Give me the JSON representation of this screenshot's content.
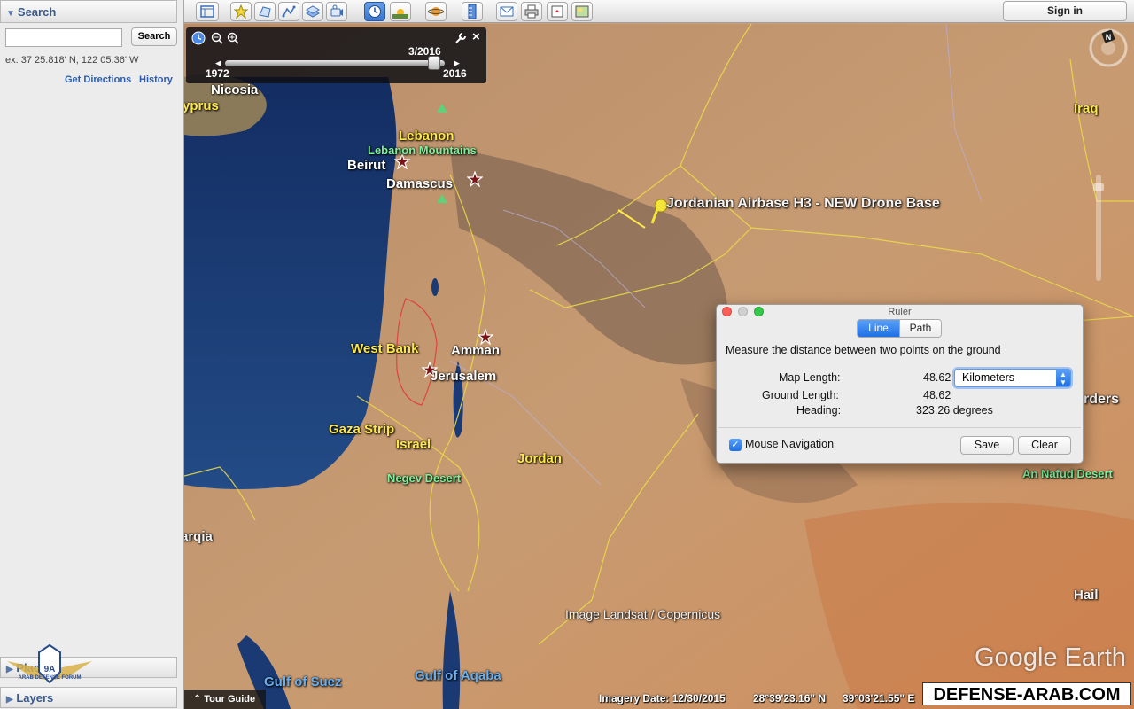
{
  "sidebar": {
    "search_header": "Search",
    "search_button": "Search",
    "search_input_value": "",
    "example_text": "ex: 37 25.818' N, 122 05.36' W",
    "get_directions": "Get Directions",
    "history": "History",
    "places_label": "Plac",
    "layers_label": "Layers",
    "logo_text": "ARAB DEFENSE FORUM"
  },
  "toolbar": {
    "sign_in": "Sign in",
    "icons": [
      "sidebar-toggle-icon",
      "placemark-icon",
      "polygon-icon",
      "path-icon",
      "image-overlay-icon",
      "record-tour-icon",
      "historical-imagery-icon",
      "sunlight-icon",
      "planets-icon",
      "ruler-icon",
      "email-icon",
      "print-icon",
      "save-image-icon",
      "view-in-maps-icon"
    ]
  },
  "time_slider": {
    "current_date": "3/2016",
    "start_year": "1972",
    "end_year": "2016",
    "position_fraction": 0.95
  },
  "map": {
    "labels": {
      "nicosia": "Nicosia",
      "cyprus": "yprus",
      "lebanon": "Lebanon",
      "lebanon_mountains": "Lebanon Mountains",
      "beirut": "Beirut",
      "damascus": "Damascus",
      "airbase": "Jordanian Airbase H3 - NEW Drone Base",
      "west_bank": "West Bank",
      "amman": "Amman",
      "jerusalem": "Jerusalem",
      "gaza_strip": "Gaza Strip",
      "israel": "Israel",
      "jordan": "Jordan",
      "negev_desert": "Negev Desert",
      "iraq": "Iraq",
      "borders": "rders",
      "an_nafud": "An Nafud Desert",
      "hail": "Hail",
      "arqia": "arqia",
      "gulf_of_suez": "Gulf of Suez",
      "gulf_of_aqaba": "Gulf of Aqaba",
      "imagery_credit": "Image Landsat / Copernicus"
    },
    "google_earth_logo": "Google Earth",
    "compass_letter": "N"
  },
  "ruler": {
    "title": "Ruler",
    "tab_line": "Line",
    "tab_path": "Path",
    "description": "Measure the distance between two points on the ground",
    "map_length_label": "Map Length:",
    "map_length_value": "48.62",
    "unit": "Kilometers",
    "ground_length_label": "Ground Length:",
    "ground_length_value": "48.62",
    "heading_label": "Heading:",
    "heading_value": "323.26 degrees",
    "mouse_navigation_label": "Mouse Navigation",
    "mouse_navigation_checked": true,
    "save": "Save",
    "clear": "Clear"
  },
  "status_bar": {
    "tour_guide": "Tour Guide",
    "imagery_date": "Imagery Date: 12/30/2015",
    "latitude": "28°39'23.16\" N",
    "longitude": "39°03'21.55\" E",
    "watermark": "DEFENSE-ARAB.COM"
  },
  "colors": {
    "water": "#1d3f7a",
    "desert": "#c79b72",
    "border_yellow": "#e9d94a",
    "accent_blue": "#1e70e6"
  }
}
